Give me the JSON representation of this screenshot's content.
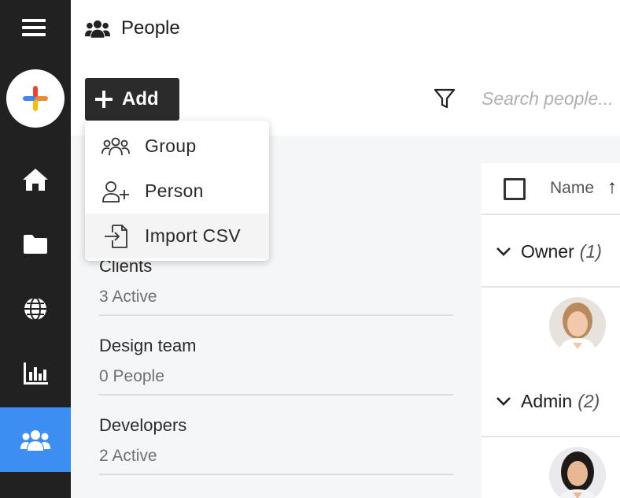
{
  "header": {
    "title": "People"
  },
  "toolbar": {
    "add_label": "Add",
    "search_placeholder": "Search people..."
  },
  "add_menu": {
    "items": [
      {
        "label": "Group",
        "icon": "group-icon"
      },
      {
        "label": "Person",
        "icon": "add-person-icon"
      },
      {
        "label": "Import CSV",
        "icon": "import-file-icon"
      }
    ]
  },
  "sidebar": {
    "items": [
      {
        "name": "home",
        "icon": "home-icon"
      },
      {
        "name": "files",
        "icon": "folder-icon"
      },
      {
        "name": "web",
        "icon": "globe-icon"
      },
      {
        "name": "reports",
        "icon": "bar-chart-icon"
      },
      {
        "name": "people",
        "icon": "people-icon",
        "active": true
      }
    ]
  },
  "groups": [
    {
      "name": "Clients",
      "sub": "3 Active"
    },
    {
      "name": "Design team",
      "sub": "0 People"
    },
    {
      "name": "Developers",
      "sub": "2 Active"
    }
  ],
  "table": {
    "name_header": "Name",
    "roles": [
      {
        "name": "Owner",
        "count": "(1)"
      },
      {
        "name": "Admin",
        "count": "(2)"
      }
    ]
  },
  "colors": {
    "sidebar_bg": "#212121",
    "active_nav": "#3d8ef3",
    "add_button": "#2b2b2b"
  }
}
